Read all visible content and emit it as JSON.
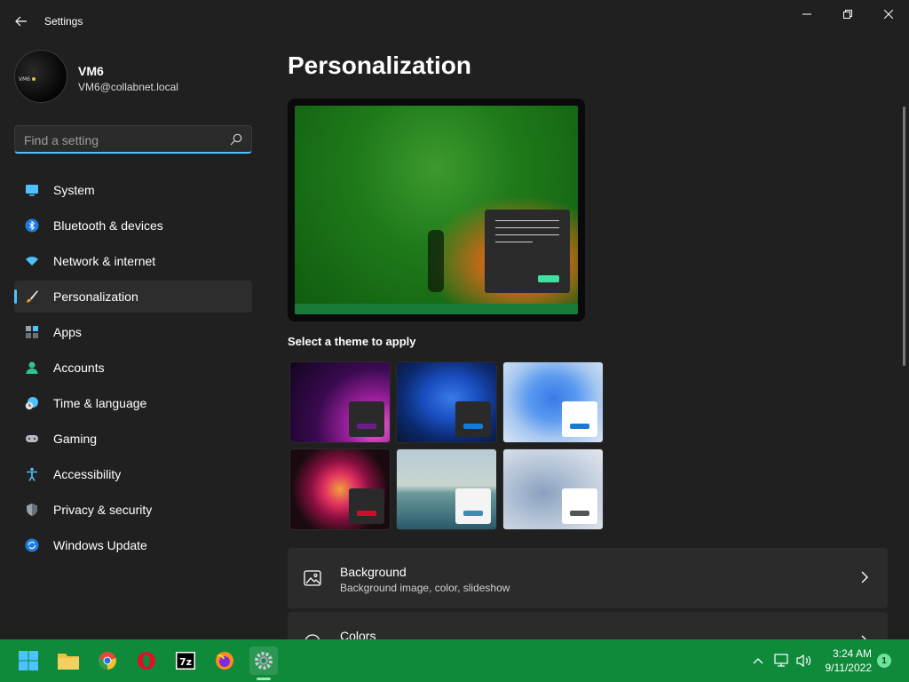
{
  "window": {
    "title": "Settings"
  },
  "profile": {
    "name": "VM6",
    "email": "VM6@collabnet.local"
  },
  "search": {
    "placeholder": "Find a setting",
    "value": ""
  },
  "sidebar": {
    "items": [
      {
        "label": "System",
        "icon": "monitor-icon",
        "active": false
      },
      {
        "label": "Bluetooth & devices",
        "icon": "bluetooth-icon",
        "active": false
      },
      {
        "label": "Network & internet",
        "icon": "wifi-icon",
        "active": false
      },
      {
        "label": "Personalization",
        "icon": "paintbrush-icon",
        "active": true
      },
      {
        "label": "Apps",
        "icon": "apps-icon",
        "active": false
      },
      {
        "label": "Accounts",
        "icon": "person-icon",
        "active": false
      },
      {
        "label": "Time & language",
        "icon": "clock-globe-icon",
        "active": false
      },
      {
        "label": "Gaming",
        "icon": "gamepad-icon",
        "active": false
      },
      {
        "label": "Accessibility",
        "icon": "accessibility-icon",
        "active": false
      },
      {
        "label": "Privacy & security",
        "icon": "shield-icon",
        "active": false
      },
      {
        "label": "Windows Update",
        "icon": "update-icon",
        "active": false
      }
    ]
  },
  "main": {
    "title": "Personalization",
    "themes_label": "Select a theme to apply",
    "themes": [
      {
        "name": "windows-glow-theme",
        "accent": "#6a1e8a"
      },
      {
        "name": "windows-dark-theme",
        "accent": "#1a7ad0"
      },
      {
        "name": "windows-light-theme",
        "accent": "#1a7ad0"
      },
      {
        "name": "captured-motion-theme",
        "accent": "#c8102e"
      },
      {
        "name": "sunrise-theme",
        "accent": "#3a8fb0"
      },
      {
        "name": "flow-theme",
        "accent": "#555555"
      }
    ],
    "cards": [
      {
        "title": "Background",
        "subtitle": "Background image, color, slideshow",
        "icon": "image-icon"
      },
      {
        "title": "Colors",
        "subtitle": "",
        "icon": "palette-icon"
      }
    ]
  },
  "taskbar": {
    "apps": [
      {
        "name": "start-icon"
      },
      {
        "name": "file-explorer-icon"
      },
      {
        "name": "chrome-icon"
      },
      {
        "name": "opera-icon"
      },
      {
        "name": "7zip-icon",
        "label": "7z"
      },
      {
        "name": "firefox-icon"
      },
      {
        "name": "settings-icon",
        "active": true
      }
    ],
    "time": "3:24 AM",
    "date": "9/11/2022",
    "notifications": "1"
  },
  "colors": {
    "accent": "#4cc2ff",
    "taskbar": "#0e8a3a",
    "background": "#202020"
  }
}
